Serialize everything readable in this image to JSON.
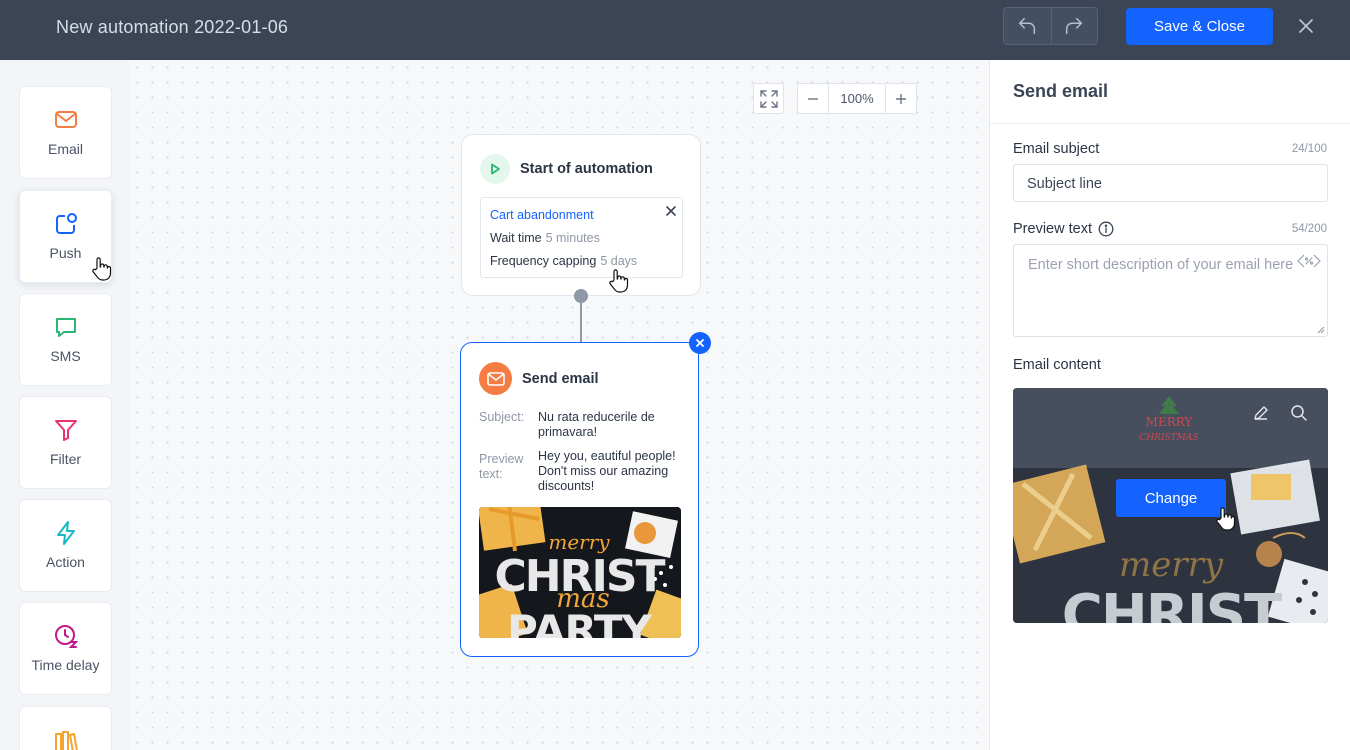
{
  "header": {
    "title": "New automation 2022-01-06",
    "save_label": "Save & Close"
  },
  "sidebar": {
    "items": [
      {
        "label": "Email",
        "icon": "mail-icon"
      },
      {
        "label": "Push",
        "icon": "push-icon"
      },
      {
        "label": "SMS",
        "icon": "chat-icon"
      },
      {
        "label": "Filter",
        "icon": "filter-icon"
      },
      {
        "label": "Action",
        "icon": "lightning-icon"
      },
      {
        "label": "Time delay",
        "icon": "clock-icon"
      },
      {
        "label": "",
        "icon": "library-icon"
      }
    ]
  },
  "canvas": {
    "zoom": "100%",
    "start_node": {
      "title": "Start of automation",
      "trigger": "Cart abandonment",
      "wait_label": "Wait time",
      "wait_value": "5 minutes",
      "freq_label": "Frequency capping",
      "freq_value": "5 days"
    },
    "email_node": {
      "title": "Send email",
      "subject_label": "Subject:",
      "subject_value": "Nu rata reducerile de primavara!",
      "preview_label": "Preview text:",
      "preview_value": "Hey you, eautiful people! Don't miss our amazing discounts!",
      "thumb_line1": "merry",
      "thumb_line2": "CHRIST",
      "thumb_line3": "mas",
      "thumb_line4": "PARTY"
    }
  },
  "panel": {
    "title": "Send email",
    "subject_label": "Email subject",
    "subject_count": "24/100",
    "subject_value": "Subject line",
    "preview_label": "Preview text",
    "preview_count": "54/200",
    "preview_placeholder": "Enter short description of your email here",
    "content_label": "Email content",
    "change_label": "Change",
    "preview_logo_line1": "MERRY",
    "preview_logo_line2": "CHRISTMAS",
    "preview_text1": "merry",
    "preview_text2": "CHRIST"
  },
  "colors": {
    "accent": "#1463ff",
    "topbar": "#3b4556",
    "email_orange": "#f57c43",
    "start_green": "#2bb673"
  }
}
